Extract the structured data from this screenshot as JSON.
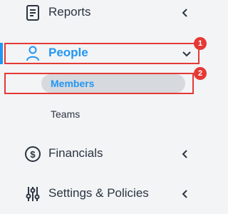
{
  "nav": {
    "reports": {
      "label": "Reports",
      "icon": "document-icon",
      "chevron": "chevron-left-icon"
    },
    "people": {
      "label": "People",
      "icon": "person-icon",
      "chevron": "chevron-down-icon",
      "color": "#2196f3"
    },
    "members": {
      "label": "Members"
    },
    "teams": {
      "label": "Teams"
    },
    "financials": {
      "label": "Financials",
      "icon": "dollar-coin-icon",
      "chevron": "chevron-left-icon"
    },
    "settings": {
      "label": "Settings & Policies",
      "icon": "sliders-icon",
      "chevron": "chevron-left-icon"
    }
  },
  "annotations": {
    "people_badge": "1",
    "members_badge": "2",
    "color": "#e53935"
  }
}
